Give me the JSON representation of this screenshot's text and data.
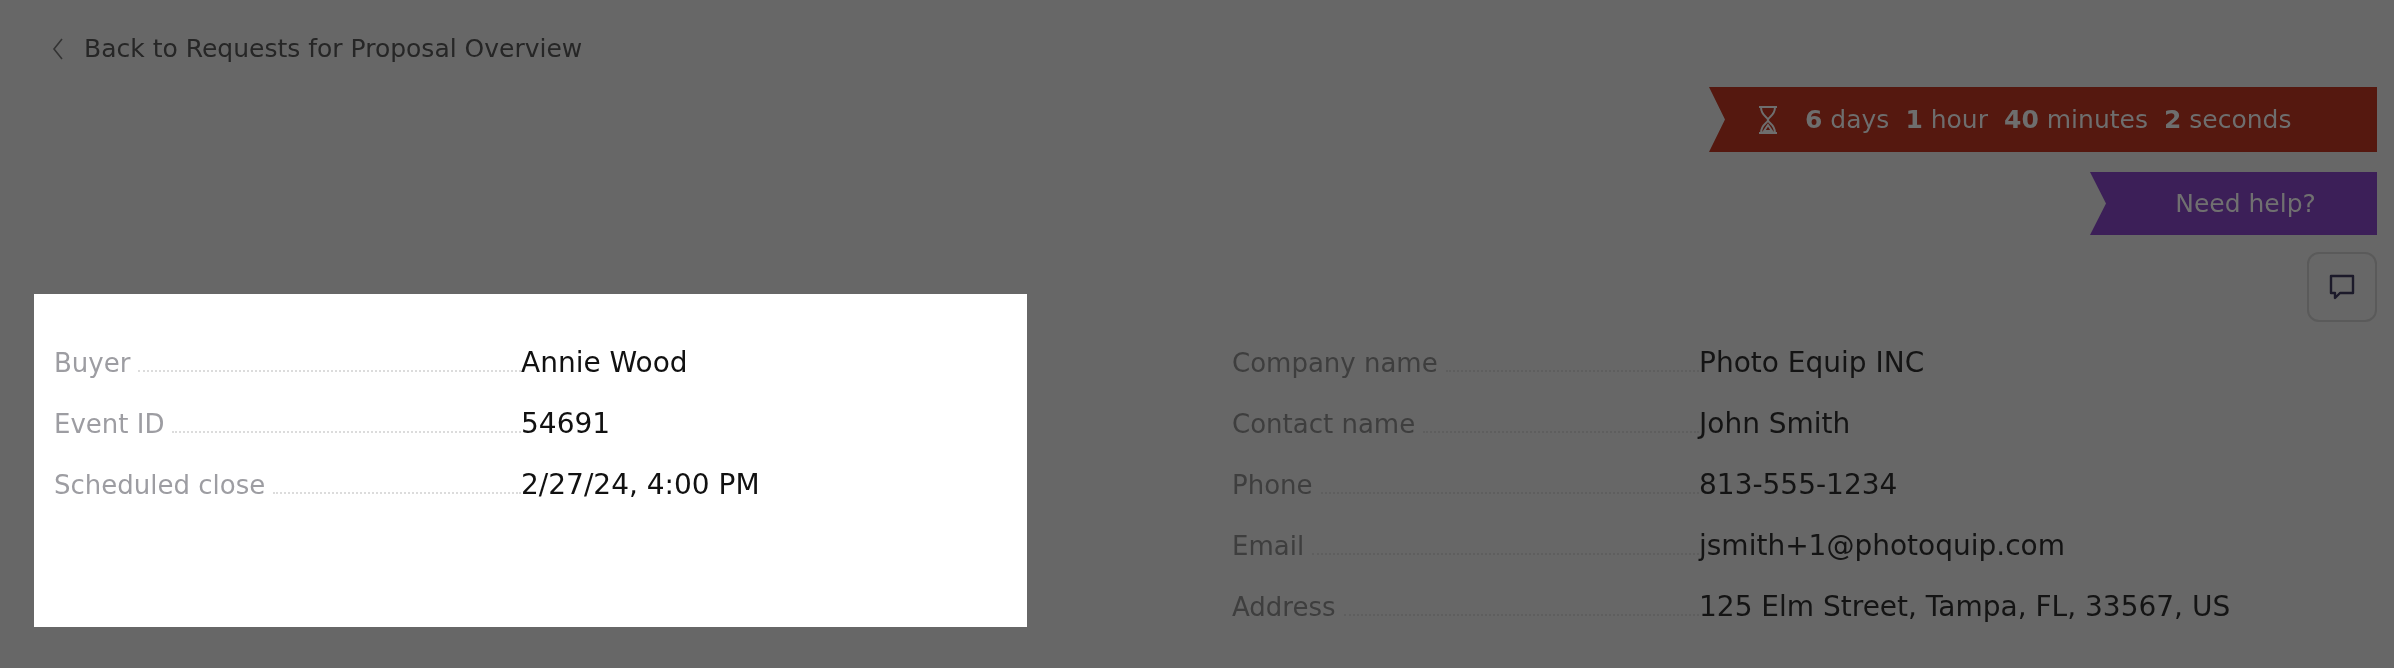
{
  "back_link": {
    "label": "Back to Requests for Proposal Overview"
  },
  "countdown": [
    {
      "value": "6",
      "unit": "days"
    },
    {
      "value": "1",
      "unit": "hour"
    },
    {
      "value": "40",
      "unit": "minutes"
    },
    {
      "value": "2",
      "unit": "seconds"
    }
  ],
  "help_button": {
    "label": "Need help?"
  },
  "event_details": [
    {
      "label": "Buyer",
      "value": "Annie Wood"
    },
    {
      "label": "Event ID",
      "value": "54691"
    },
    {
      "label": "Scheduled close",
      "value": "2/27/24, 4:00 PM"
    }
  ],
  "supplier_details": [
    {
      "label": "Company name",
      "value": "Photo Equip INC"
    },
    {
      "label": "Contact name",
      "value": "John Smith"
    },
    {
      "label": "Phone",
      "value": "813-555-1234"
    },
    {
      "label": "Email",
      "value": "jsmith+1@photoquip.com"
    },
    {
      "label": "Address",
      "value": "125 Elm Street, Tampa, FL, 33567, US"
    }
  ]
}
